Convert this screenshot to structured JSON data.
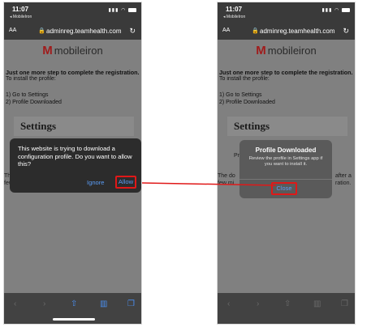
{
  "left_screen": {
    "status": {
      "time": "11:07",
      "back_app": "◂ MobileIron"
    },
    "url_bar": {
      "text_size": "AA",
      "url": "adminreg.teamhealth.com"
    },
    "logo": {
      "text": "mobileiron"
    },
    "content": {
      "intro": "Just one more step to complete the registration.",
      "install": "To install the profile:",
      "step1": "1) Go to Settings",
      "step2": "2) Profile Downloaded",
      "settings_heading": "Settings",
      "frag_the": "The",
      "frag_few": "few"
    },
    "dialog": {
      "message": "This website is trying to download a configuration profile. Do you want to allow this?",
      "ignore": "Ignore",
      "allow": "Allow"
    }
  },
  "right_screen": {
    "status": {
      "time": "11:07",
      "back_app": "◂ MobileIron"
    },
    "url_bar": {
      "text_size": "AA",
      "url": "adminreg.teamhealth.com"
    },
    "logo": {
      "text": "mobileiron"
    },
    "content": {
      "intro": "Just one more step to complete the registration.",
      "install": "To install the profile:",
      "step1": "1) Go to Settings",
      "step2": "2) Profile Downloaded",
      "settings_heading": "Settings",
      "frag_pr": "Pr",
      "frag_the_do": "The do",
      "frag_after": "after a",
      "frag_few_mi": "few mi",
      "frag_ration": "ration."
    },
    "alert": {
      "title": "Profile Downloaded",
      "body": "Review the profile in Settings app if you want to install it.",
      "close": "Close"
    }
  },
  "icons": [
    "signal-icon",
    "wifi-icon",
    "battery-icon",
    "lock-icon",
    "reload-icon",
    "back-icon",
    "forward-icon",
    "share-icon",
    "bookmarks-icon",
    "tabs-icon"
  ],
  "colors": {
    "highlight": "#e01818",
    "link": "#5a9cf5",
    "brand": "#a01b1b"
  }
}
